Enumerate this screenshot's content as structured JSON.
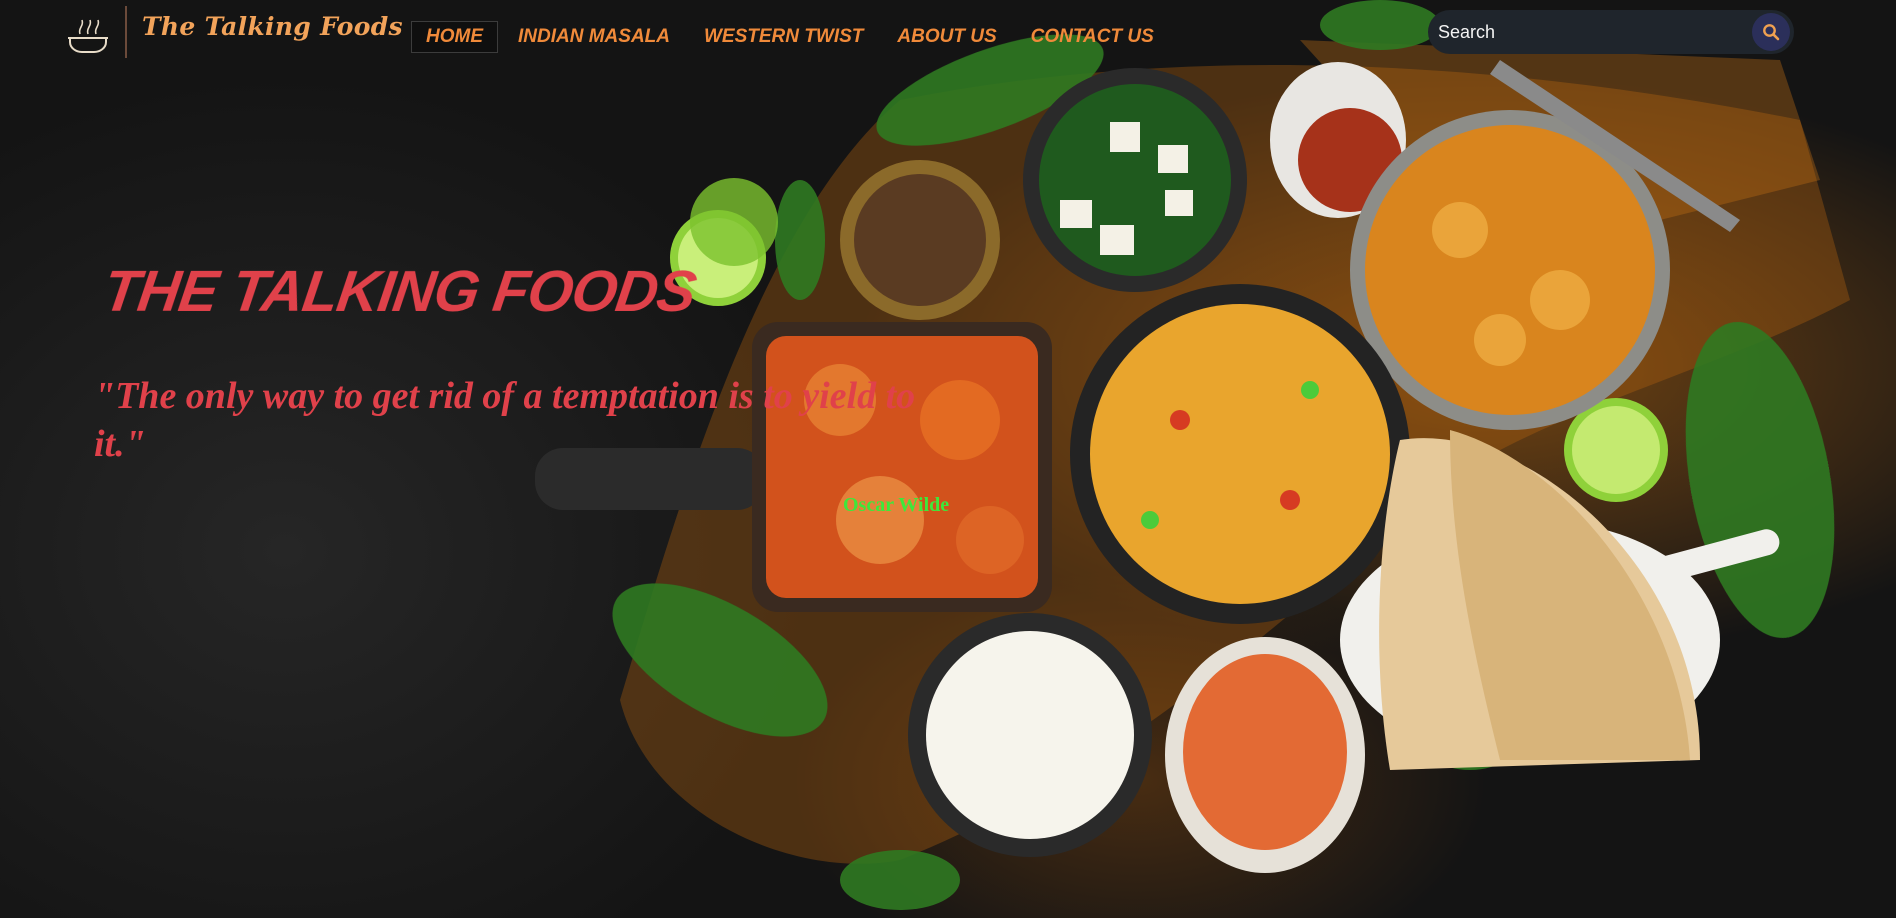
{
  "header": {
    "brand": "The Talking Foods",
    "nav": [
      {
        "label": "HOME",
        "active": true
      },
      {
        "label": "INDIAN MASALA",
        "active": false
      },
      {
        "label": "WESTERN TWIST",
        "active": false
      },
      {
        "label": "ABOUT US",
        "active": false
      },
      {
        "label": "CONTACT US",
        "active": false
      }
    ],
    "search": {
      "placeholder": "Search",
      "value": ""
    }
  },
  "hero": {
    "title": "THE TALKING FOODS",
    "quote": "\"The only way to get rid of a temptation is to yield to it.\"",
    "author": "Oscar Wilde"
  },
  "icons": {
    "logo": "cooking-pot-icon",
    "search": "search-icon"
  },
  "colors": {
    "accent": "#e0414a",
    "nav": "#f08a3a",
    "brand": "#f2a35a",
    "author": "#3ee83a",
    "search_bg": "#1f252c",
    "search_button": "#2b2f5a"
  }
}
